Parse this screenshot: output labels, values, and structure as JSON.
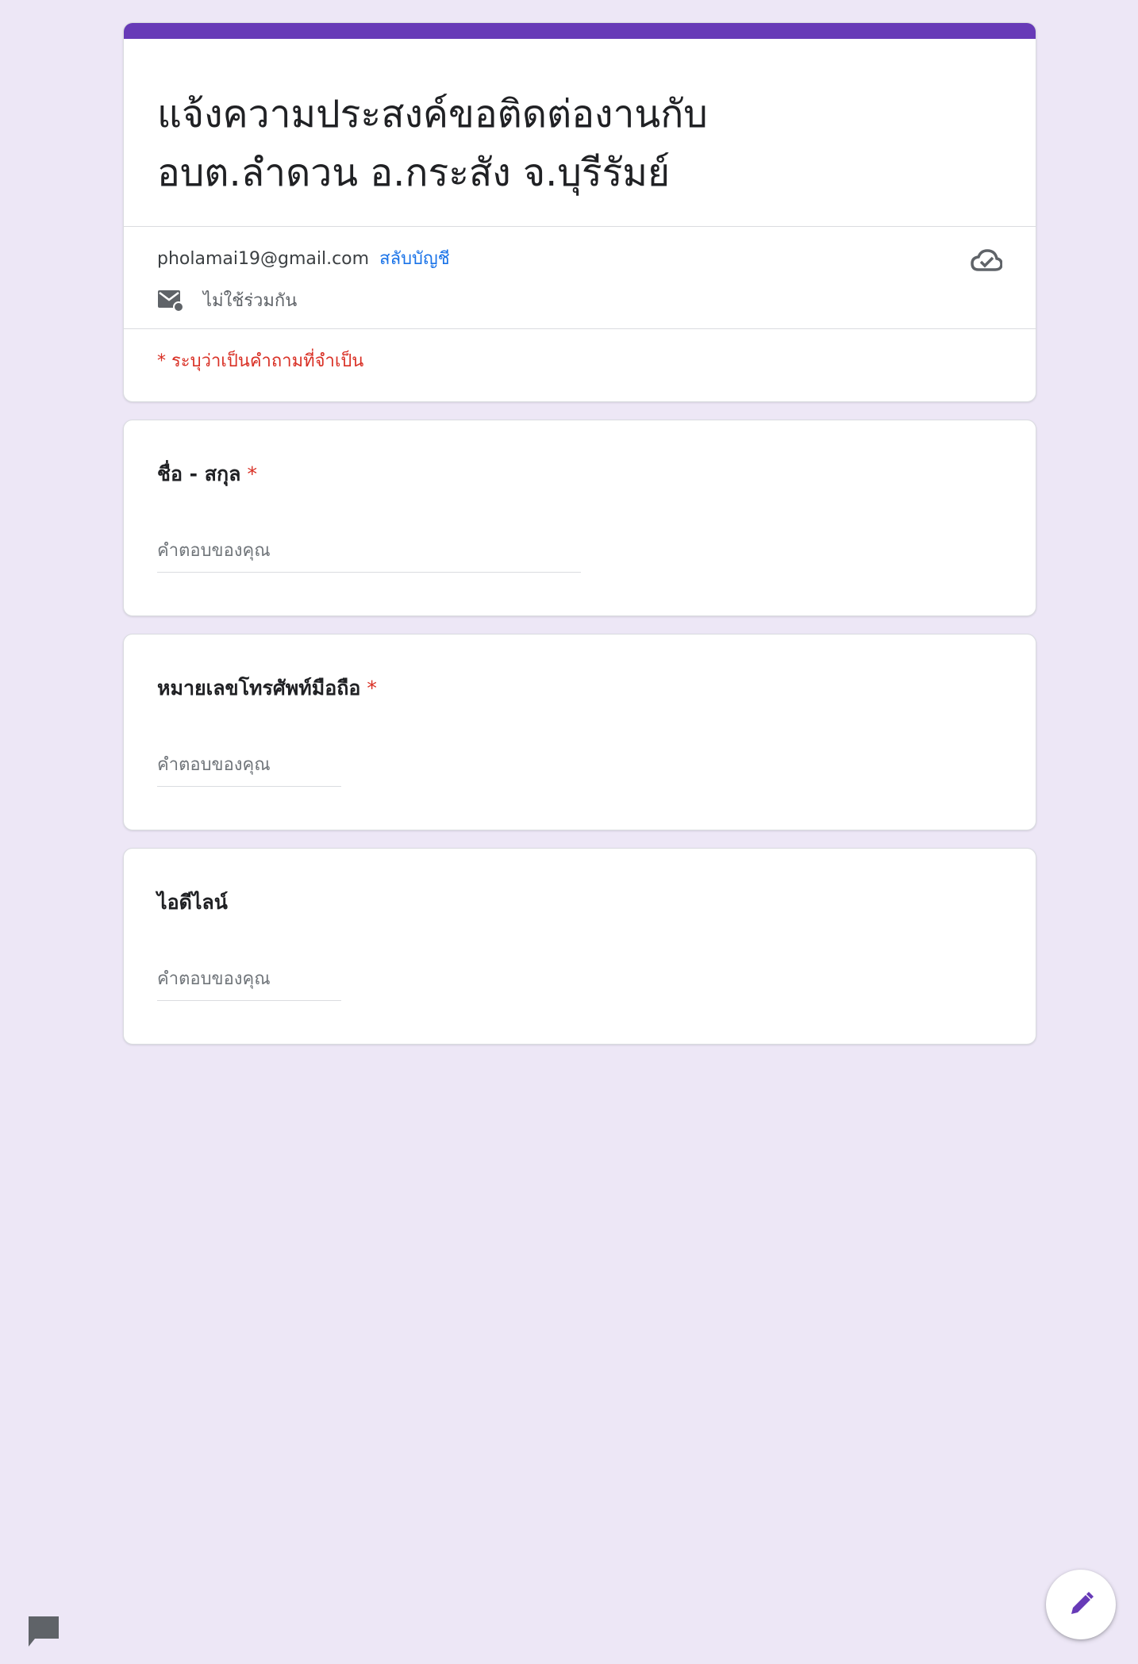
{
  "form": {
    "title_line1": "แจ้งความประสงค์ขอติดต่องานกับ",
    "title_line2": "อบต.ลำดวน อ.กระสัง จ.บุรีรัมย์",
    "account_email": "pholamai19@gmail.com",
    "switch_account_label": "สลับบัญชี",
    "not_shared_label": "ไม่ใช้ร่วมกัน",
    "required_note": "* ระบุว่าเป็นคำถามที่จำเป็น",
    "accent_color": "#673ab7",
    "required_color": "#d93025",
    "link_color": "#1a73e8"
  },
  "questions": [
    {
      "label": "ชื่อ - สกุล",
      "required_mark": "*",
      "placeholder": "คำตอบของคุณ"
    },
    {
      "label": "หมายเลขโทรศัพท์มือถือ",
      "required_mark": "*",
      "placeholder": "คำตอบของคุณ"
    },
    {
      "label": "ไอดีไลน์",
      "placeholder": "คำตอบของคุณ"
    }
  ],
  "icons": {
    "cloud": "cloud-saved-icon",
    "mail": "mail-not-shared-icon",
    "edit": "pencil-icon",
    "feedback": "feedback-icon"
  }
}
